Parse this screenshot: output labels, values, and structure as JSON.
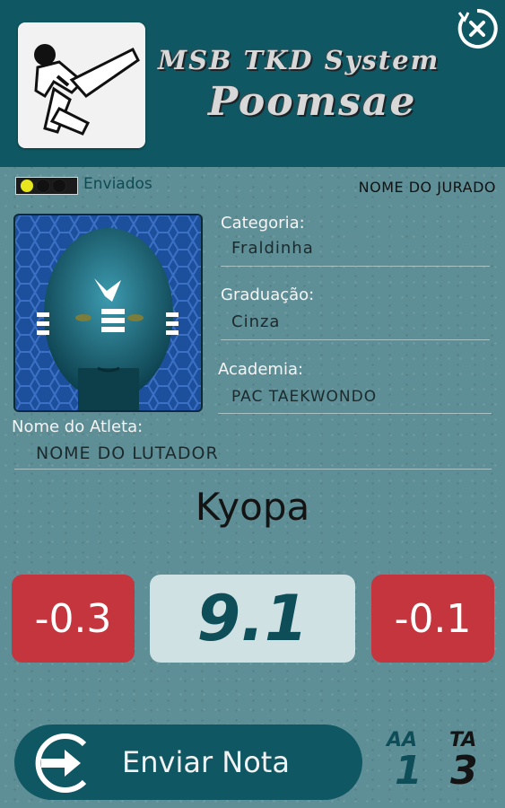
{
  "header": {
    "title_line1": "MSB TKD System",
    "title_line2": "Poomsae",
    "logo_icon": "taekwondo-kick-logo-icon",
    "close_icon": "close-circle-icon"
  },
  "status": {
    "enviados_label": "Enviados",
    "judge_name": "NOME DO JURADO",
    "indicator_dots": [
      "yellow",
      "black",
      "black"
    ]
  },
  "athlete": {
    "photo_icon": "athlete-face-avatar",
    "categoria_label": "Categoria:",
    "categoria_value": "Fraldinha",
    "graduacao_label": "Graduação:",
    "graduacao_value": "Cinza",
    "academia_label": "Academia:",
    "academia_value": "PAC TAEKWONDO",
    "nome_label": "Nome do Atleta:",
    "nome_value": "NOME DO LUTADOR"
  },
  "poomsae_name": "Kyopa",
  "scores": {
    "left_deduction": "-0.3",
    "current_score": "9.1",
    "right_deduction": "-0.1"
  },
  "actions": {
    "send_label": "Enviar Nota",
    "send_icon": "arrow-circle-right-icon"
  },
  "stats": {
    "aa_label": "AA",
    "aa_value": "1",
    "ta_label": "TA",
    "ta_value": "3"
  },
  "colors": {
    "header_bg": "#0f5863",
    "body_bg": "#5f8f96",
    "deduction": "#c5353e",
    "score_box": "#cfe1e3",
    "accent_text": "#0e4e59"
  }
}
